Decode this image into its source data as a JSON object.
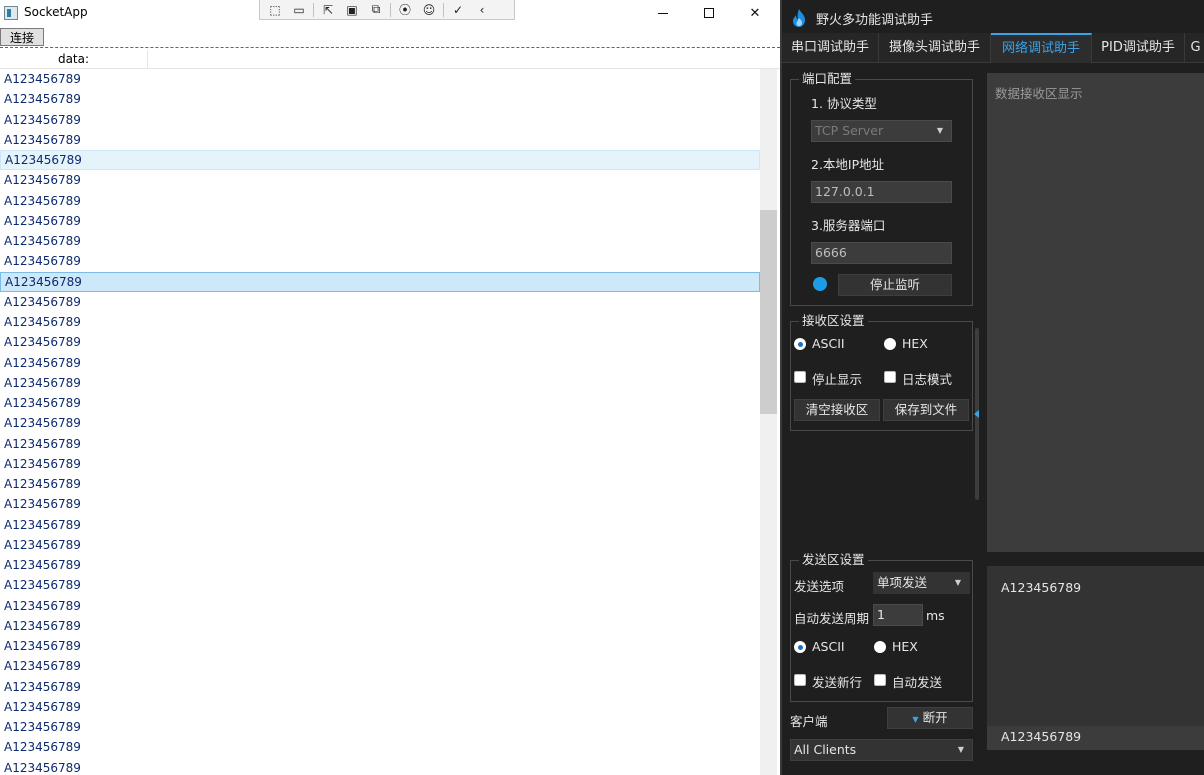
{
  "socket_app": {
    "title": "SocketApp",
    "connect_button": "连接",
    "column_header": "data:",
    "rows": [
      "A123456789",
      "A123456789",
      "A123456789",
      "A123456789",
      "A123456789",
      "A123456789",
      "A123456789",
      "A123456789",
      "A123456789",
      "A123456789",
      "A123456789",
      "A123456789",
      "A123456789",
      "A123456789",
      "A123456789",
      "A123456789",
      "A123456789",
      "A123456789",
      "A123456789",
      "A123456789",
      "A123456789",
      "A123456789",
      "A123456789",
      "A123456789",
      "A123456789",
      "A123456789",
      "A123456789",
      "A123456789",
      "A123456789",
      "A123456789",
      "A123456789",
      "A123456789",
      "A123456789",
      "A123456789",
      "A123456789"
    ],
    "hover_row_index": 4,
    "selected_row_index": 10,
    "scroll_position_fraction": 0.28
  },
  "debug_helper": {
    "title": "野火多功能调试助手",
    "tabs": [
      "串口调试助手",
      "摄像头调试助手",
      "网络调试助手",
      "PID调试助手",
      "G"
    ],
    "active_tab_index": 2,
    "port_config": {
      "title": "端口配置",
      "protocol_label": "1. 协议类型",
      "protocol_value": "TCP Server",
      "ip_label": "2.本地IP地址",
      "ip_value": "127.0.0.1",
      "port_label": "3.服务器端口",
      "port_value": "6666",
      "stop_listen_button": "停止监听"
    },
    "receive_settings": {
      "title": "接收区设置",
      "ascii_label": "ASCII",
      "hex_label": "HEX",
      "stop_display_label": "停止显示",
      "log_mode_label": "日志模式",
      "clear_button": "清空接收区",
      "save_button": "保存到文件"
    },
    "receive_area_placeholder": "数据接收区显示",
    "send_settings": {
      "title": "发送区设置",
      "send_option_label": "发送选项",
      "send_option_value": "单项发送",
      "auto_period_label": "自动发送周期",
      "auto_period_value": "1",
      "auto_period_unit": "ms",
      "ascii_label": "ASCII",
      "hex_label": "HEX",
      "send_newline_label": "发送新行",
      "auto_send_label": "自动发送"
    },
    "client_label": "客户端",
    "disconnect_button": "断开",
    "clients_value": "All Clients",
    "send_area_text": "A123456789",
    "send_input_text": "A123456789",
    "colors": {
      "accent": "#3aa3e8",
      "status_dot": "#1e9be6",
      "background": "#1f1f1f"
    }
  }
}
